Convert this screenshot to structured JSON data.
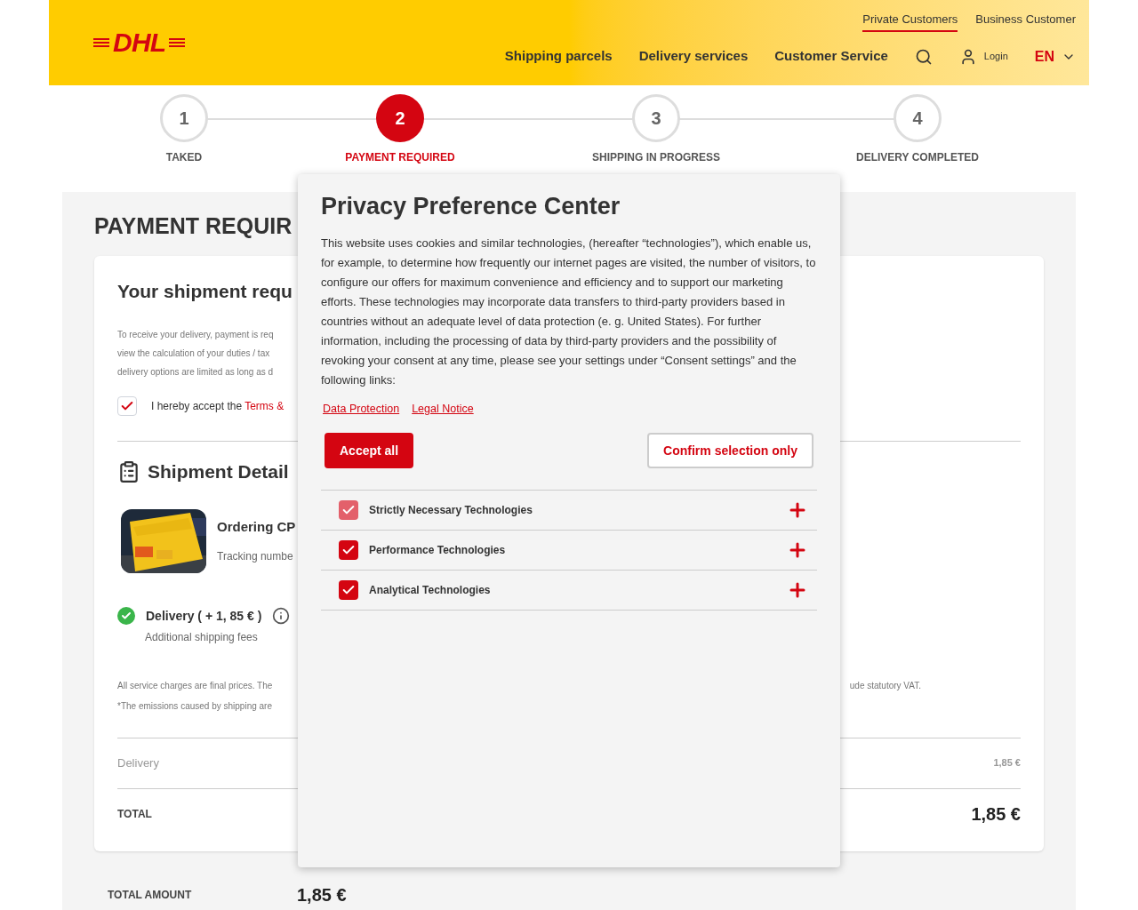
{
  "header": {
    "logo": "DHL",
    "top_links": [
      {
        "label": "Private Customers",
        "selected": true
      },
      {
        "label": "Business Customer",
        "selected": false
      }
    ],
    "nav": [
      "Shipping parcels",
      "Delivery services",
      "Customer Service"
    ],
    "login": "Login",
    "language": "EN"
  },
  "stepper": [
    {
      "number": "1",
      "label": "TAKED",
      "selected": false
    },
    {
      "number": "2",
      "label": "PAYMENT REQUIRED",
      "selected": true
    },
    {
      "number": "3",
      "label": "SHIPPING IN PROGRESS",
      "selected": false
    },
    {
      "number": "4",
      "label": "DELIVERY COMPLETED",
      "selected": false
    }
  ],
  "page": {
    "title": "PAYMENT REQUIR",
    "card_title": "Your shipment requ",
    "intro_lines": [
      "To receive your delivery, payment is req",
      "view the calculation of your duties / tax",
      "delivery options are limited as long as d"
    ],
    "terms": {
      "checked": true,
      "text": "I hereby accept the ",
      "link": "Terms &"
    },
    "details_title": "Shipment Detail",
    "item": {
      "name": "Ordering CP",
      "tracking": "Tracking numbe"
    },
    "delivery_option": {
      "selected": true,
      "label": "Delivery ( + 1, 85 € )",
      "sub": "Additional shipping fees"
    },
    "notes": [
      {
        "left": "All service charges are final prices. The",
        "right": "ude statutory VAT."
      },
      {
        "left": "*The emissions caused by shipping are"
      }
    ],
    "summary": [
      {
        "label": "Delivery",
        "value": "1,85 €",
        "kind": "line"
      },
      {
        "label": "TOTAL",
        "value": "1,85 €",
        "kind": "total"
      }
    ],
    "total_amount": {
      "label": "TOTAL AMOUNT",
      "value": "1,85 €"
    }
  },
  "modal": {
    "title": "Privacy Preference Center",
    "body": "This website uses cookies and similar technologies, (hereafter “technologies”), which enable us, for example, to determine how frequently our internet pages are visited, the number of visitors, to configure our offers for maximum convenience and efficiency and to support our marketing efforts. These technologies may incorporate data transfers to third-party providers based in countries without an adequate level of data protection (e. g. United States). For further information, including the processing of data by third-party providers and the possibility of revoking your consent at any time, please see your settings under “Consent settings” and the following links:",
    "links": [
      "Data Protection",
      "Legal Notice"
    ],
    "accept": "Accept all",
    "confirm": "Confirm selection only",
    "categories": [
      {
        "label": "Strictly Necessary Technologies",
        "checked": true,
        "disabled": true,
        "expanded": false
      },
      {
        "label": "Performance Technologies",
        "checked": true,
        "disabled": false,
        "expanded": false
      },
      {
        "label": "Analytical Technologies",
        "checked": true,
        "disabled": false,
        "expanded": false
      }
    ]
  }
}
